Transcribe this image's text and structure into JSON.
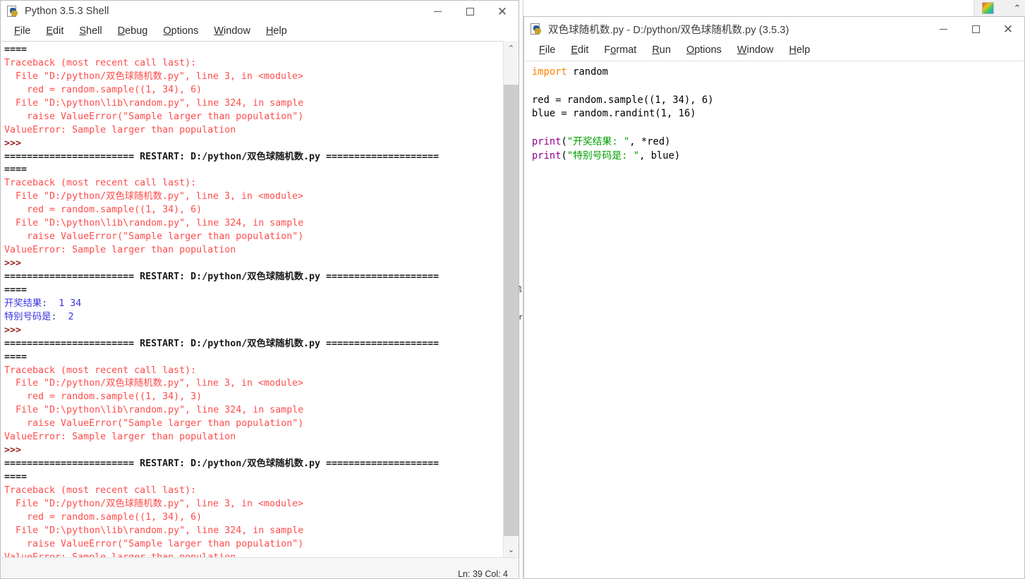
{
  "background": {
    "behind_window_chars": [
      "弟",
      "or"
    ],
    "equalizer_name": "taskbar-gadget"
  },
  "shell": {
    "title": "Python 3.5.3 Shell",
    "icon": "python-idle-icon",
    "window_buttons": {
      "minimize": "–",
      "maximize": "□",
      "close": "✕"
    },
    "menu": [
      {
        "label": "File",
        "accel": "F"
      },
      {
        "label": "Edit",
        "accel": "E"
      },
      {
        "label": "Shell",
        "accel": "S"
      },
      {
        "label": "Debug",
        "accel": "D"
      },
      {
        "label": "Options",
        "accel": "O"
      },
      {
        "label": "Window",
        "accel": "W"
      },
      {
        "label": "Help",
        "accel": "H"
      }
    ],
    "status": "Ln: 39 Col: 4",
    "scrollbar": {
      "up_arrow": "⌃",
      "down_arrow": "⌄"
    },
    "lines": [
      {
        "text": "====",
        "style": "sep"
      },
      {
        "text": "Traceback (most recent call last):",
        "style": "err"
      },
      {
        "text": "  File \"D:/python/双色球随机数.py\", line 3, in <module>",
        "style": "err"
      },
      {
        "text": "    red = random.sample((1, 34), 6)",
        "style": "err"
      },
      {
        "text": "  File \"D:\\python\\lib\\random.py\", line 324, in sample",
        "style": "err"
      },
      {
        "text": "    raise ValueError(\"Sample larger than population\")",
        "style": "err"
      },
      {
        "text": "ValueError: Sample larger than population",
        "style": "err"
      },
      {
        "text": ">>> ",
        "style": "prompt"
      },
      {
        "text": "======================= RESTART: D:/python/双色球随机数.py ====================",
        "style": "sep"
      },
      {
        "text": "====",
        "style": "sep"
      },
      {
        "text": "Traceback (most recent call last):",
        "style": "err"
      },
      {
        "text": "  File \"D:/python/双色球随机数.py\", line 3, in <module>",
        "style": "err"
      },
      {
        "text": "    red = random.sample((1, 34), 6)",
        "style": "err"
      },
      {
        "text": "  File \"D:\\python\\lib\\random.py\", line 324, in sample",
        "style": "err"
      },
      {
        "text": "    raise ValueError(\"Sample larger than population\")",
        "style": "err"
      },
      {
        "text": "ValueError: Sample larger than population",
        "style": "err"
      },
      {
        "text": ">>> ",
        "style": "prompt"
      },
      {
        "text": "======================= RESTART: D:/python/双色球随机数.py ====================",
        "style": "sep"
      },
      {
        "text": "====",
        "style": "sep"
      },
      {
        "text": "开奖结果:  1 34",
        "style": "out"
      },
      {
        "text": "特别号码是:  2",
        "style": "out"
      },
      {
        "text": ">>> ",
        "style": "prompt"
      },
      {
        "text": "======================= RESTART: D:/python/双色球随机数.py ====================",
        "style": "sep"
      },
      {
        "text": "====",
        "style": "sep"
      },
      {
        "text": "Traceback (most recent call last):",
        "style": "err"
      },
      {
        "text": "  File \"D:/python/双色球随机数.py\", line 3, in <module>",
        "style": "err"
      },
      {
        "text": "    red = random.sample((1, 34), 3)",
        "style": "err"
      },
      {
        "text": "  File \"D:\\python\\lib\\random.py\", line 324, in sample",
        "style": "err"
      },
      {
        "text": "    raise ValueError(\"Sample larger than population\")",
        "style": "err"
      },
      {
        "text": "ValueError: Sample larger than population",
        "style": "err"
      },
      {
        "text": ">>> ",
        "style": "prompt"
      },
      {
        "text": "======================= RESTART: D:/python/双色球随机数.py ====================",
        "style": "sep"
      },
      {
        "text": "====",
        "style": "sep"
      },
      {
        "text": "Traceback (most recent call last):",
        "style": "err"
      },
      {
        "text": "  File \"D:/python/双色球随机数.py\", line 3, in <module>",
        "style": "err"
      },
      {
        "text": "    red = random.sample((1, 34), 6)",
        "style": "err"
      },
      {
        "text": "  File \"D:\\python\\lib\\random.py\", line 324, in sample",
        "style": "err"
      },
      {
        "text": "    raise ValueError(\"Sample larger than population\")",
        "style": "err"
      },
      {
        "text": "ValueError: Sample larger than population",
        "style": "err"
      },
      {
        "text": ">>> ",
        "style": "prompt"
      }
    ]
  },
  "editor": {
    "title": "双色球随机数.py - D:/python/双色球随机数.py (3.5.3)",
    "icon": "python-idle-icon",
    "window_buttons": {
      "minimize": "–",
      "maximize": "□",
      "close": "✕"
    },
    "menu": [
      {
        "label": "File",
        "accel": "F"
      },
      {
        "label": "Edit",
        "accel": "E"
      },
      {
        "label": "Format",
        "accel": "o"
      },
      {
        "label": "Run",
        "accel": "R"
      },
      {
        "label": "Options",
        "accel": "O"
      },
      {
        "label": "Window",
        "accel": "W"
      },
      {
        "label": "Help",
        "accel": "H"
      }
    ],
    "code_lines": [
      [
        {
          "t": "import",
          "c": "kw"
        },
        {
          "t": " random",
          "c": ""
        }
      ],
      [
        {
          "t": "",
          "c": ""
        }
      ],
      [
        {
          "t": "red = random.sample((1, 34), 6)",
          "c": ""
        }
      ],
      [
        {
          "t": "blue = random.randint(1, 16)",
          "c": ""
        }
      ],
      [
        {
          "t": "",
          "c": ""
        }
      ],
      [
        {
          "t": "print",
          "c": "bi"
        },
        {
          "t": "(",
          "c": ""
        },
        {
          "t": "\"开奖结果: \"",
          "c": "str"
        },
        {
          "t": ", *red)",
          "c": ""
        }
      ],
      [
        {
          "t": "print",
          "c": "bi"
        },
        {
          "t": "(",
          "c": ""
        },
        {
          "t": "\"特别号码是: \"",
          "c": "str"
        },
        {
          "t": ", blue)",
          "c": ""
        }
      ]
    ]
  },
  "colors": {
    "error_text": "#ff4c4c",
    "output_text": "#3a33e0",
    "prompt": "#9b2020",
    "keyword": "#ff8000",
    "builtin": "#900090",
    "string": "#00a000"
  }
}
